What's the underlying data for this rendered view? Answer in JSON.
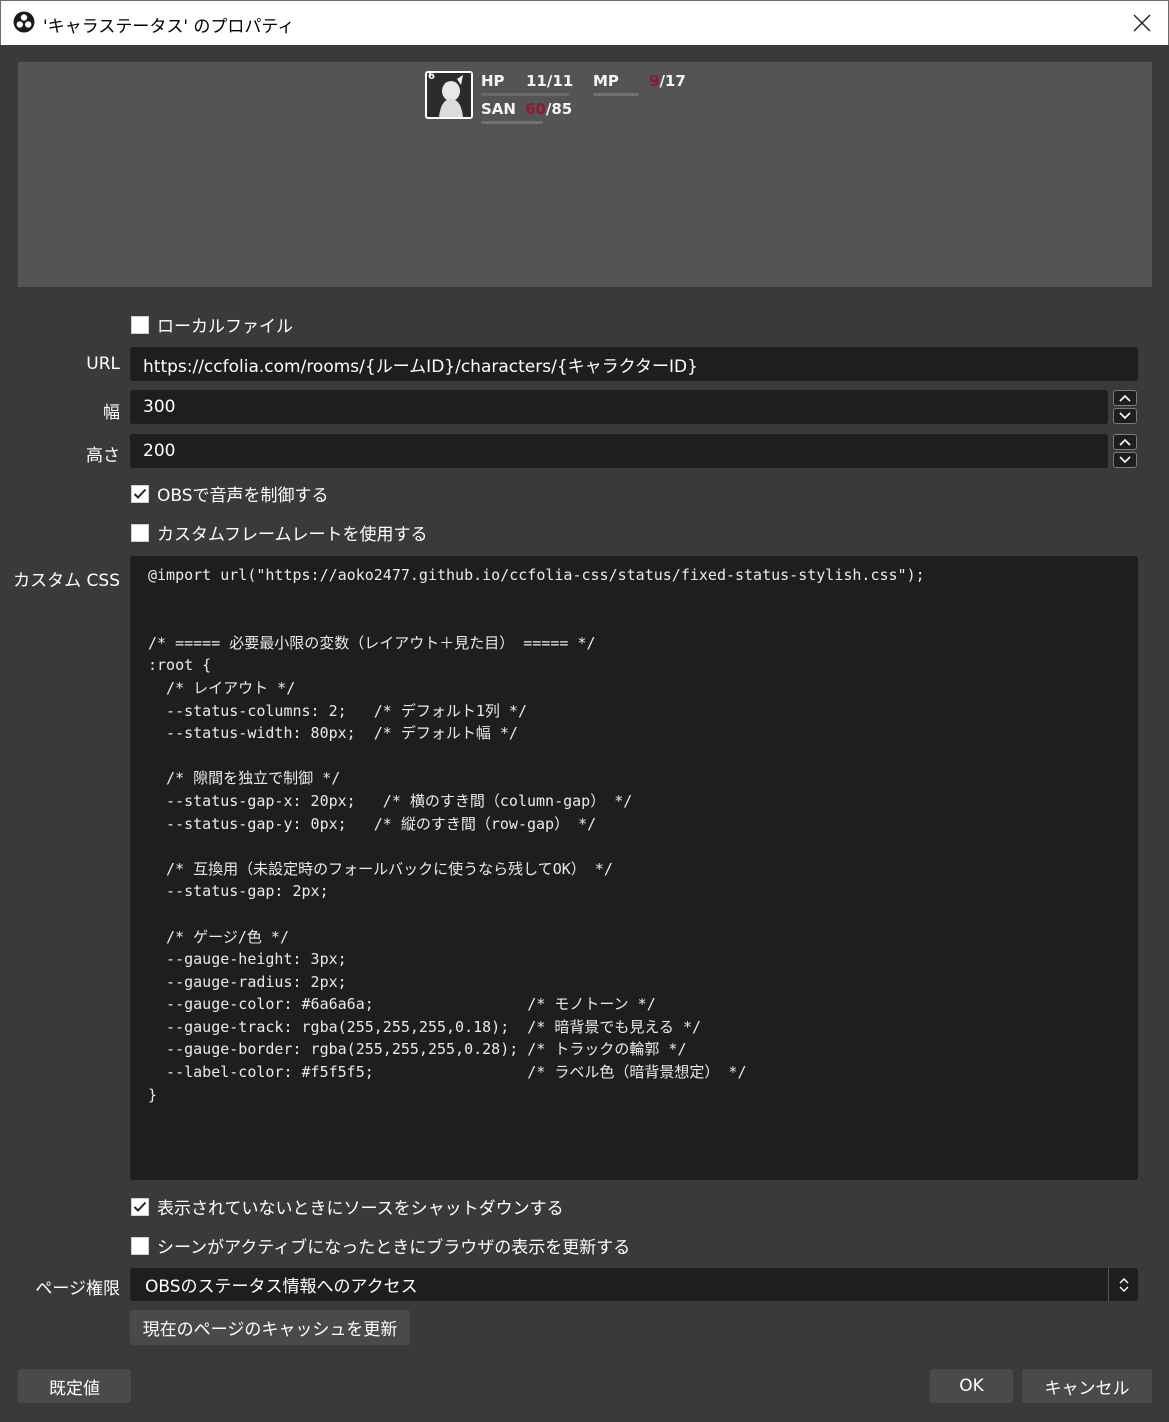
{
  "window": {
    "title": "'キャラステータス' のプロパティ",
    "app_icon": "obs-logo-icon",
    "close_icon": "close-icon"
  },
  "preview": {
    "badge": "6",
    "hp_label": "HP",
    "hp_value": "11/11",
    "hp_fill": 1.0,
    "mp_label": "MP",
    "mp_current": "9",
    "mp_max": "/17",
    "mp_fill": 0.0,
    "san_label": "SAN",
    "san_current": "60",
    "san_max": "/85",
    "san_fill": 0.0,
    "accent_red": "#8a1c2e"
  },
  "form": {
    "local_file_label": "ローカルファイル",
    "local_file_checked": false,
    "url_label": "URL",
    "url_value": "https://ccfolia.com/rooms/{ルームID}/characters/{キャラクターID}",
    "width_label": "幅",
    "width_value": "300",
    "height_label": "高さ",
    "height_value": "200",
    "obs_audio_label": "OBSで音声を制御する",
    "obs_audio_checked": true,
    "custom_fps_label": "カスタムフレームレートを使用する",
    "custom_fps_checked": false,
    "custom_css_label": "カスタム CSS",
    "shutdown_label": "表示されていないときにソースをシャットダウンする",
    "shutdown_checked": true,
    "refresh_label": "シーンがアクティブになったときにブラウザの表示を更新する",
    "refresh_checked": false,
    "page_perm_label": "ページ権限",
    "page_perm_value": "OBSのステータス情報へのアクセス",
    "refresh_cache_button": "現在のページのキャッシュを更新"
  },
  "css_lines": [
    "@import url(\"https://aoko2477.github.io/ccfolia-css/status/fixed-status-stylish.css\");",
    "",
    "",
    "/* ===== 必要最小限の変数（レイアウト＋見た目） ===== */",
    ":root {",
    "  /* レイアウト */",
    "  --status-columns: 2;   /* デフォルト1列 */",
    "  --status-width: 80px;  /* デフォルト幅 */",
    "",
    "  /* 隙間を独立で制御 */",
    "  --status-gap-x: 20px;   /* 横のすき間（column-gap） */",
    "  --status-gap-y: 0px;   /* 縦のすき間（row-gap） */",
    "",
    "  /* 互換用（未設定時のフォールバックに使うなら残してOK） */",
    "  --status-gap: 2px;",
    "",
    "  /* ゲージ/色 */",
    "  --gauge-height: 3px;",
    "  --gauge-radius: 2px;",
    "  --gauge-color: #6a6a6a;                 /* モノトーン */",
    "  --gauge-track: rgba(255,255,255,0.18);  /* 暗背景でも見える */",
    "  --gauge-border: rgba(255,255,255,0.28); /* トラックの輪郭 */",
    "  --label-color: #f5f5f5;                 /* ラベル色（暗背景想定） */",
    "}"
  ],
  "footer": {
    "defaults_button": "既定値",
    "ok_button": "OK",
    "cancel_button": "キャンセル"
  }
}
